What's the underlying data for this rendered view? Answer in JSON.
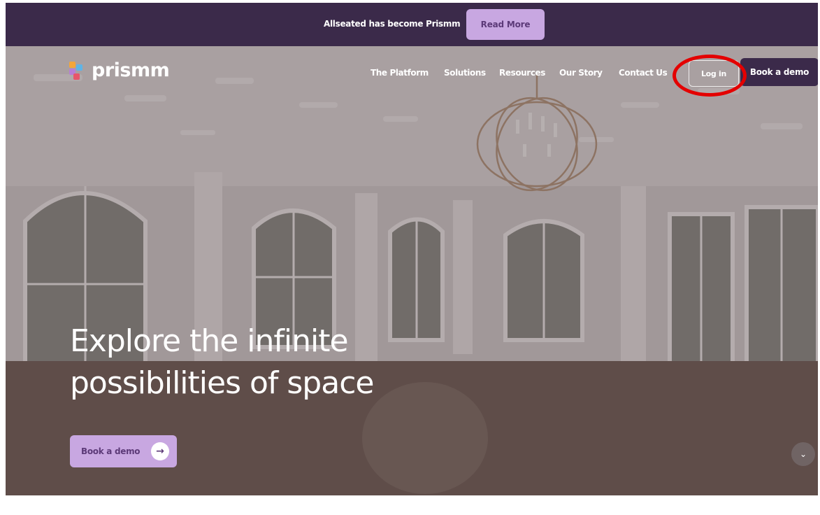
{
  "announcement": {
    "text": "Allseated has become Prismm",
    "button_label": "Read More"
  },
  "brand": {
    "name": "prismm",
    "logo_colors": [
      "#f4a63a",
      "#5fb4e6",
      "#b77fd6",
      "#e8566b"
    ]
  },
  "nav": {
    "items": [
      "The Platform",
      "Solutions",
      "Resources",
      "Our Story",
      "Contact Us"
    ],
    "login_label": "Log in",
    "demo_label": "Book a demo"
  },
  "hero": {
    "headline_line1": "Explore the infinite",
    "headline_line2": "possibilities of space",
    "cta_label": "Book a demo",
    "cta_icon": "arrow-right-icon",
    "scroll_icon": "chevron-down-icon"
  },
  "colors": {
    "brand_dark": "#3b2a4a",
    "brand_light": "#c8a7e1",
    "annotation_red": "#e40000"
  }
}
